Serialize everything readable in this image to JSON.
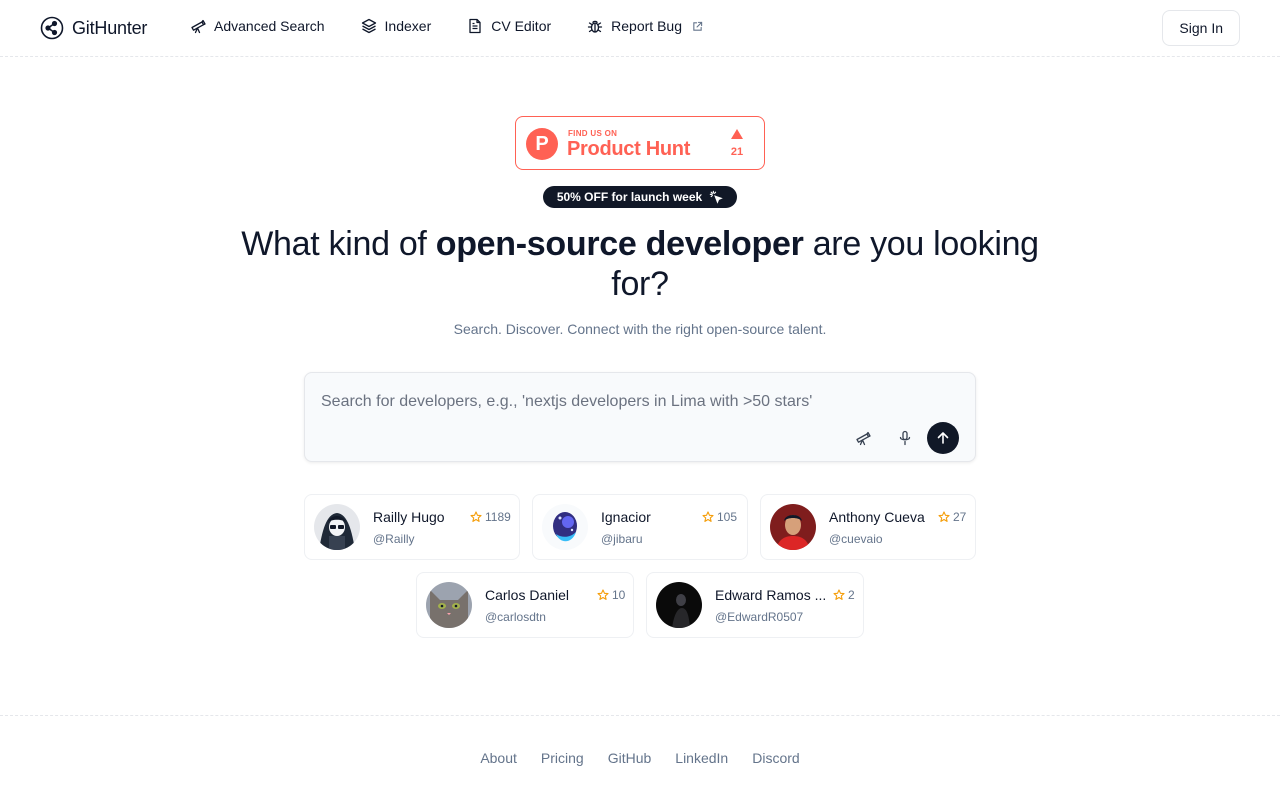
{
  "header": {
    "logo_text": "GitHunter",
    "nav": [
      {
        "label": "Advanced Search",
        "icon": "telescope-icon"
      },
      {
        "label": "Indexer",
        "icon": "layers-icon"
      },
      {
        "label": "CV Editor",
        "icon": "document-icon"
      },
      {
        "label": "Report Bug",
        "icon": "bug-icon"
      }
    ],
    "sign_in": "Sign In"
  },
  "product_hunt": {
    "small_text": "FIND US ON",
    "big_text": "Product Hunt",
    "logo_letter": "P",
    "upvotes": "21"
  },
  "promo": {
    "text": "50% OFF for launch week"
  },
  "hero": {
    "headline_pre": "What kind of ",
    "headline_bold": "open-source developer",
    "headline_post": " are you looking for?",
    "subtitle": "Search. Discover. Connect with the right open-source talent."
  },
  "search": {
    "placeholder": "Search for developers, e.g., 'nextjs developers in Lima with >50 stars'",
    "value": ""
  },
  "developers": [
    {
      "name": "Railly Hugo",
      "handle": "@Railly",
      "stars": "1189"
    },
    {
      "name": "Ignacior",
      "handle": "@jibaru",
      "stars": "105"
    },
    {
      "name": "Anthony Cueva",
      "handle": "@cuevaio",
      "stars": "27"
    },
    {
      "name": "Carlos Daniel",
      "handle": "@carlosdtn",
      "stars": "10"
    },
    {
      "name": "Edward Ramos ...",
      "handle": "@EdwardR0507",
      "stars": "2"
    }
  ],
  "footer": {
    "links": [
      "About",
      "Pricing",
      "GitHub",
      "LinkedIn",
      "Discord"
    ]
  },
  "colors": {
    "accent_dark": "#111827",
    "product_hunt": "#ff6154",
    "star": "#f59e0b",
    "muted_text": "#64748b"
  }
}
